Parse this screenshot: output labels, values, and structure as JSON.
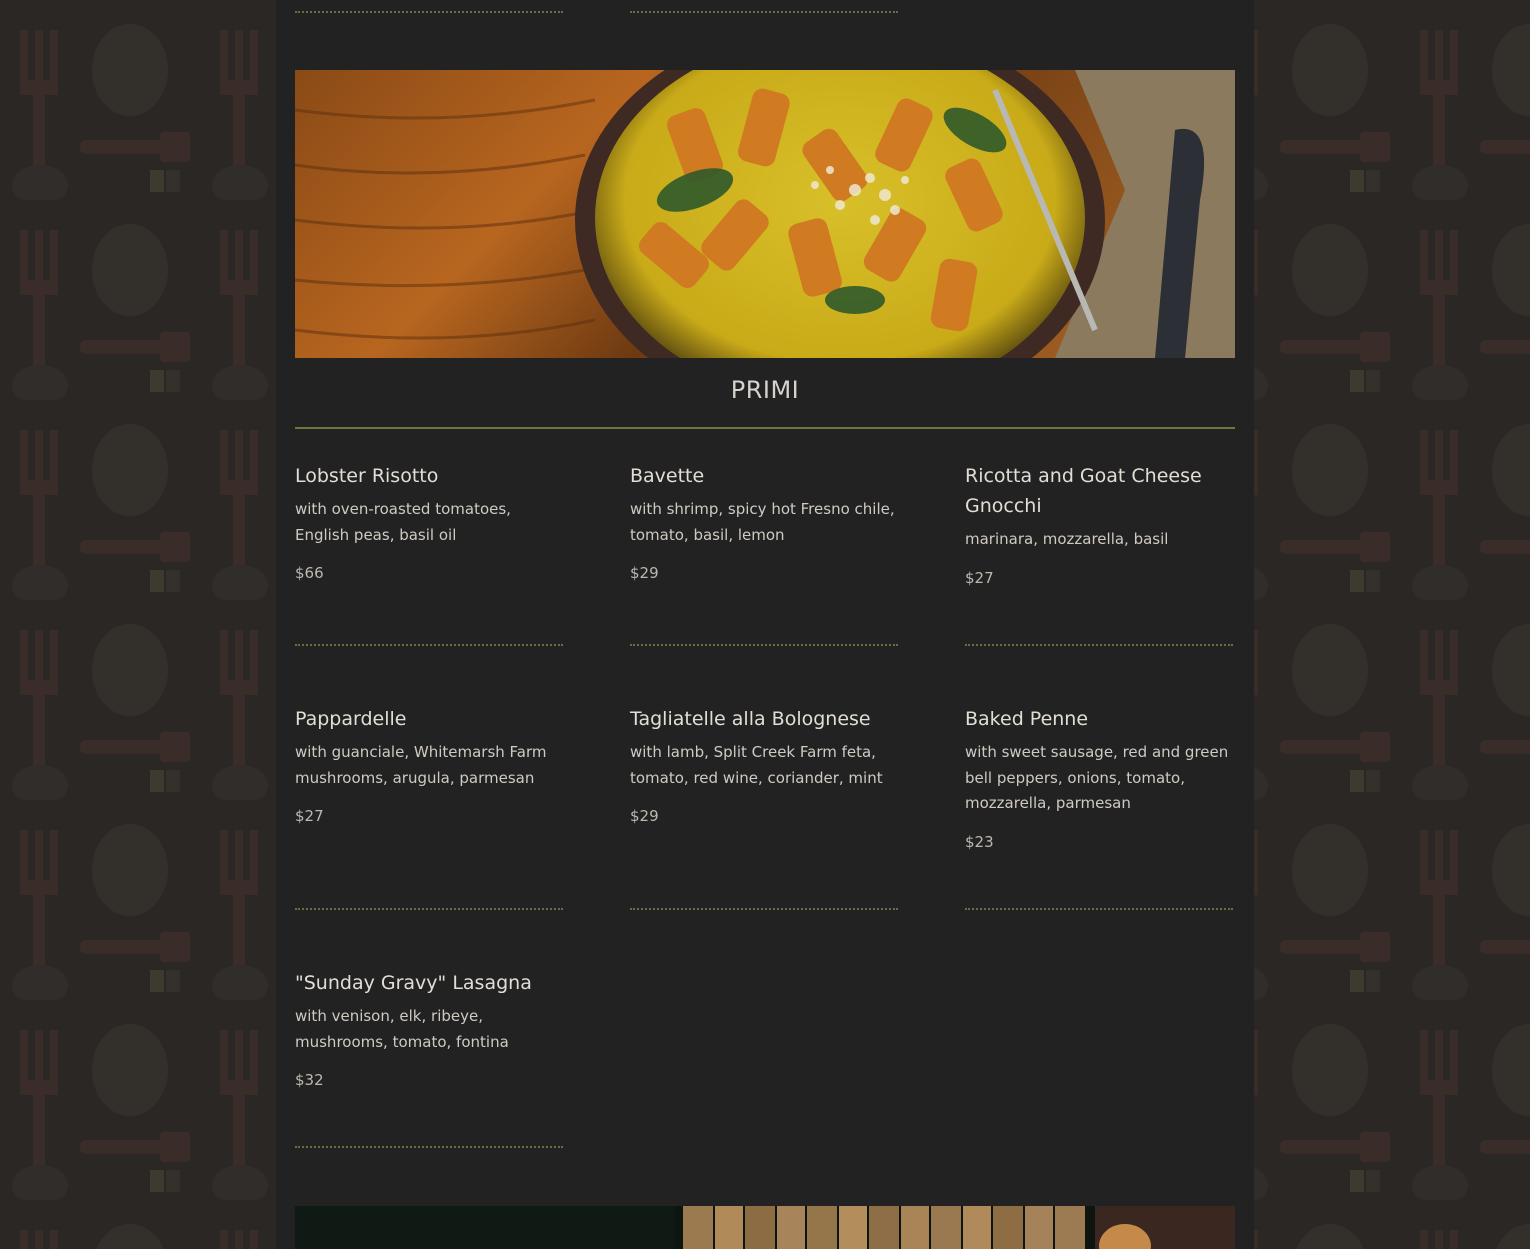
{
  "section": {
    "title": "PRIMI"
  },
  "images": {
    "hero": "pasta-dish-image",
    "bottom": "restaurant-interior-image"
  },
  "colors": {
    "background": "#2b2725",
    "panel": "#222222",
    "accent": "#6a7a3a",
    "text": "#e2ddd5"
  },
  "items": [
    {
      "name": "Lobster Risotto",
      "description": "with oven-roasted tomatoes, English peas, basil oil",
      "price": "$66"
    },
    {
      "name": "Bavette",
      "description": "with shrimp, spicy hot Fresno chile, tomato, basil, lemon",
      "price": "$29"
    },
    {
      "name": "Ricotta and Goat Cheese Gnocchi",
      "description": "marinara, mozzarella, basil",
      "price": "$27"
    },
    {
      "name": "Pappardelle",
      "description": "with guanciale, Whitemarsh Farm mushrooms, arugula, parmesan",
      "price": "$27"
    },
    {
      "name": "Tagliatelle alla Bolognese",
      "description": "with lamb, Split Creek Farm feta, tomato, red wine, coriander, mint",
      "price": "$29"
    },
    {
      "name": "Baked Penne",
      "description": "with sweet sausage, red and green bell peppers, onions, tomato, mozzarella, parmesan",
      "price": "$23"
    },
    {
      "name": "\"Sunday Gravy\" Lasagna",
      "description": "with venison, elk, ribeye, mushrooms, tomato, fontina",
      "price": "$32"
    }
  ]
}
